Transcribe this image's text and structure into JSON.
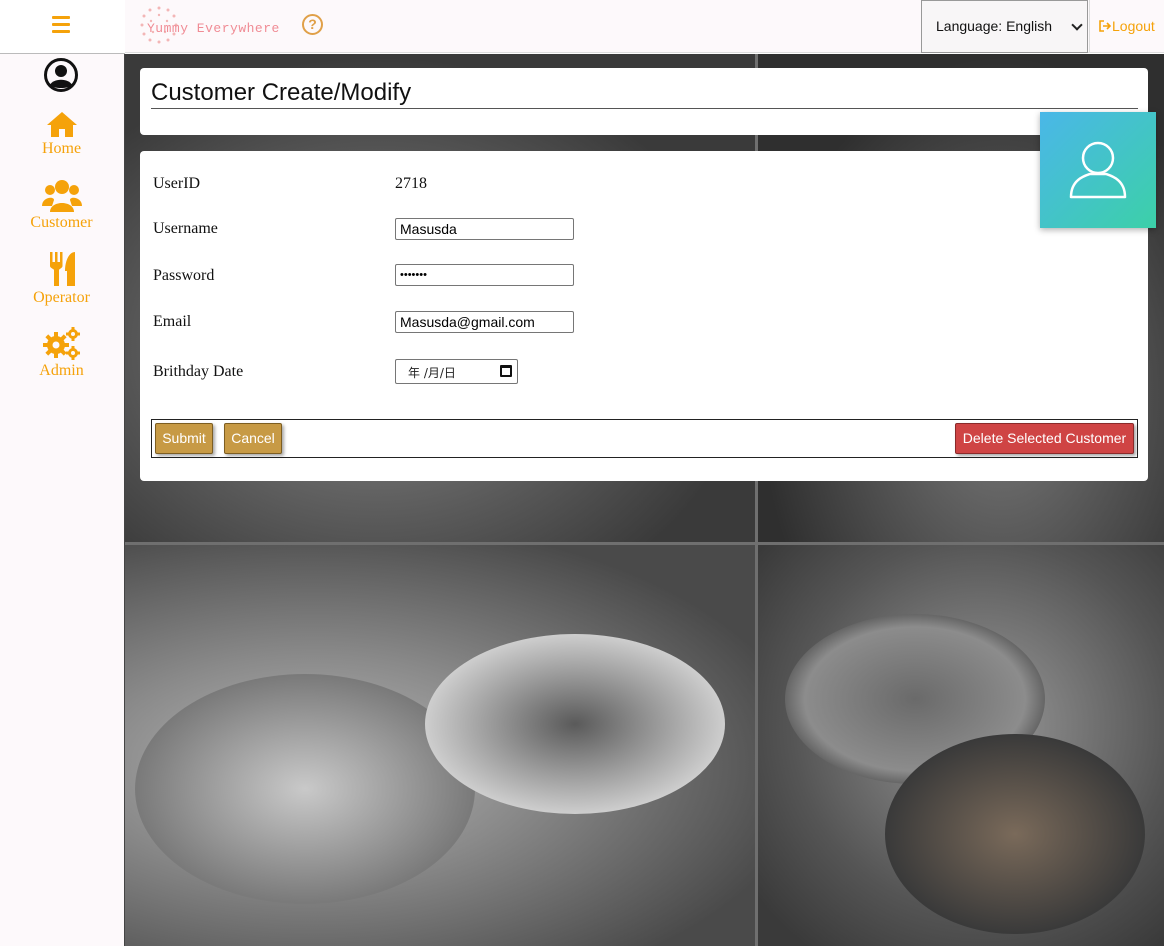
{
  "app": {
    "logo_text": "Yummy Everywhere",
    "help_glyph": "?"
  },
  "topbar": {
    "language_label": "Language: English",
    "logout_label": "Logout"
  },
  "sidebar": {
    "items": [
      {
        "label": "Home",
        "icon": "home-icon"
      },
      {
        "label": "Customer",
        "icon": "users-icon"
      },
      {
        "label": "Operator",
        "icon": "utensils-icon"
      },
      {
        "label": "Admin",
        "icon": "cogs-icon"
      }
    ]
  },
  "page": {
    "title": "Customer Create/Modify"
  },
  "form": {
    "userid_label": "UserID",
    "userid_value": "2718",
    "username_label": "Username",
    "username_value": "Masusda",
    "password_label": "Password",
    "password_value": "•••••••",
    "email_label": "Email",
    "email_value": "Masusda@gmail.com",
    "birthday_label": "Brithday Date",
    "birthday_placeholder": "年  /月/日"
  },
  "actions": {
    "submit_label": "Submit",
    "cancel_label": "Cancel",
    "delete_label": "Delete Selected Customer"
  },
  "colors": {
    "accent": "#f5a20a",
    "button_gold": "#c79a45",
    "danger": "#cf4444"
  }
}
